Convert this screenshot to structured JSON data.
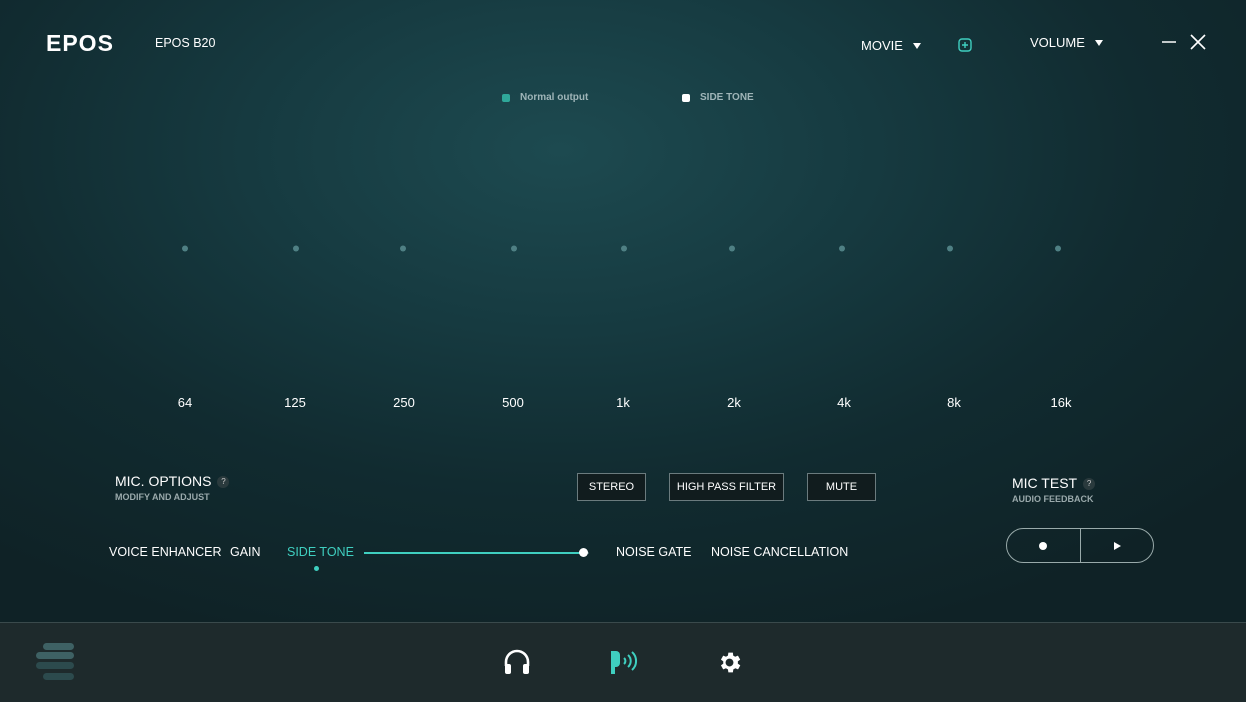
{
  "header": {
    "logo": "EPOS",
    "device_name": "EPOS B20",
    "preset_label": "MOVIE",
    "mode_label": "VOLUME"
  },
  "legend": {
    "items": [
      {
        "label": "Normal output",
        "color": "#2fa89a"
      },
      {
        "label": "SIDE TONE",
        "color": "#ffffff"
      }
    ]
  },
  "eq": {
    "frequencies": [
      "64",
      "125",
      "250",
      "500",
      "1k",
      "2k",
      "4k",
      "8k",
      "16k"
    ]
  },
  "mic_options": {
    "title": "MIC. OPTIONS",
    "subtitle": "MODIFY AND ADJUST",
    "help": "?",
    "buttons": {
      "stereo": "STEREO",
      "high_pass": "HIGH PASS FILTER",
      "mute": "MUTE"
    },
    "tabs": {
      "voice_enhancer": "VOICE ENHANCER",
      "gain": "GAIN",
      "side_tone": "SIDE TONE",
      "noise_gate": "NOISE GATE",
      "noise_cancellation": "NOISE CANCELLATION"
    },
    "side_tone_level": 1.0
  },
  "mic_test": {
    "title": "MIC TEST",
    "subtitle": "AUDIO FEEDBACK",
    "help": "?"
  },
  "colors": {
    "accent": "#3fcfc0",
    "footer_bg": "#1e2a2c"
  }
}
